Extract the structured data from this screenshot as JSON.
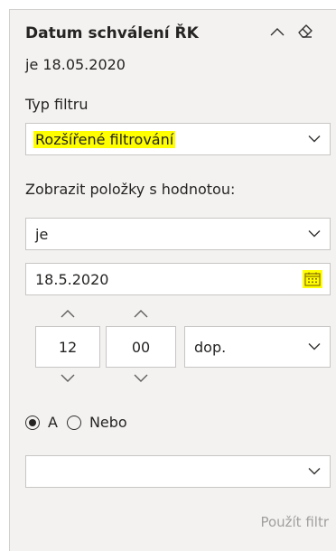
{
  "header": {
    "title": "Datum schválení ŘK",
    "subtitle": "je 18.05.2020"
  },
  "filter_type": {
    "label": "Typ filtru",
    "value": "Rozšířené filtrování",
    "highlight_color": "#ffff00"
  },
  "condition": {
    "label": "Zobrazit položky s hodnotou:",
    "operator": "je",
    "date": "18.5.2020",
    "hour": "12",
    "minute": "00",
    "ampm": "dop."
  },
  "logic": {
    "option_and": "A",
    "option_or": "Nebo",
    "selected": "A"
  },
  "second_operator": "",
  "apply_label": "Použít filtr",
  "icons": [
    "chevron-up-icon",
    "eraser-icon",
    "chevron-down-icon",
    "calendar-icon"
  ]
}
